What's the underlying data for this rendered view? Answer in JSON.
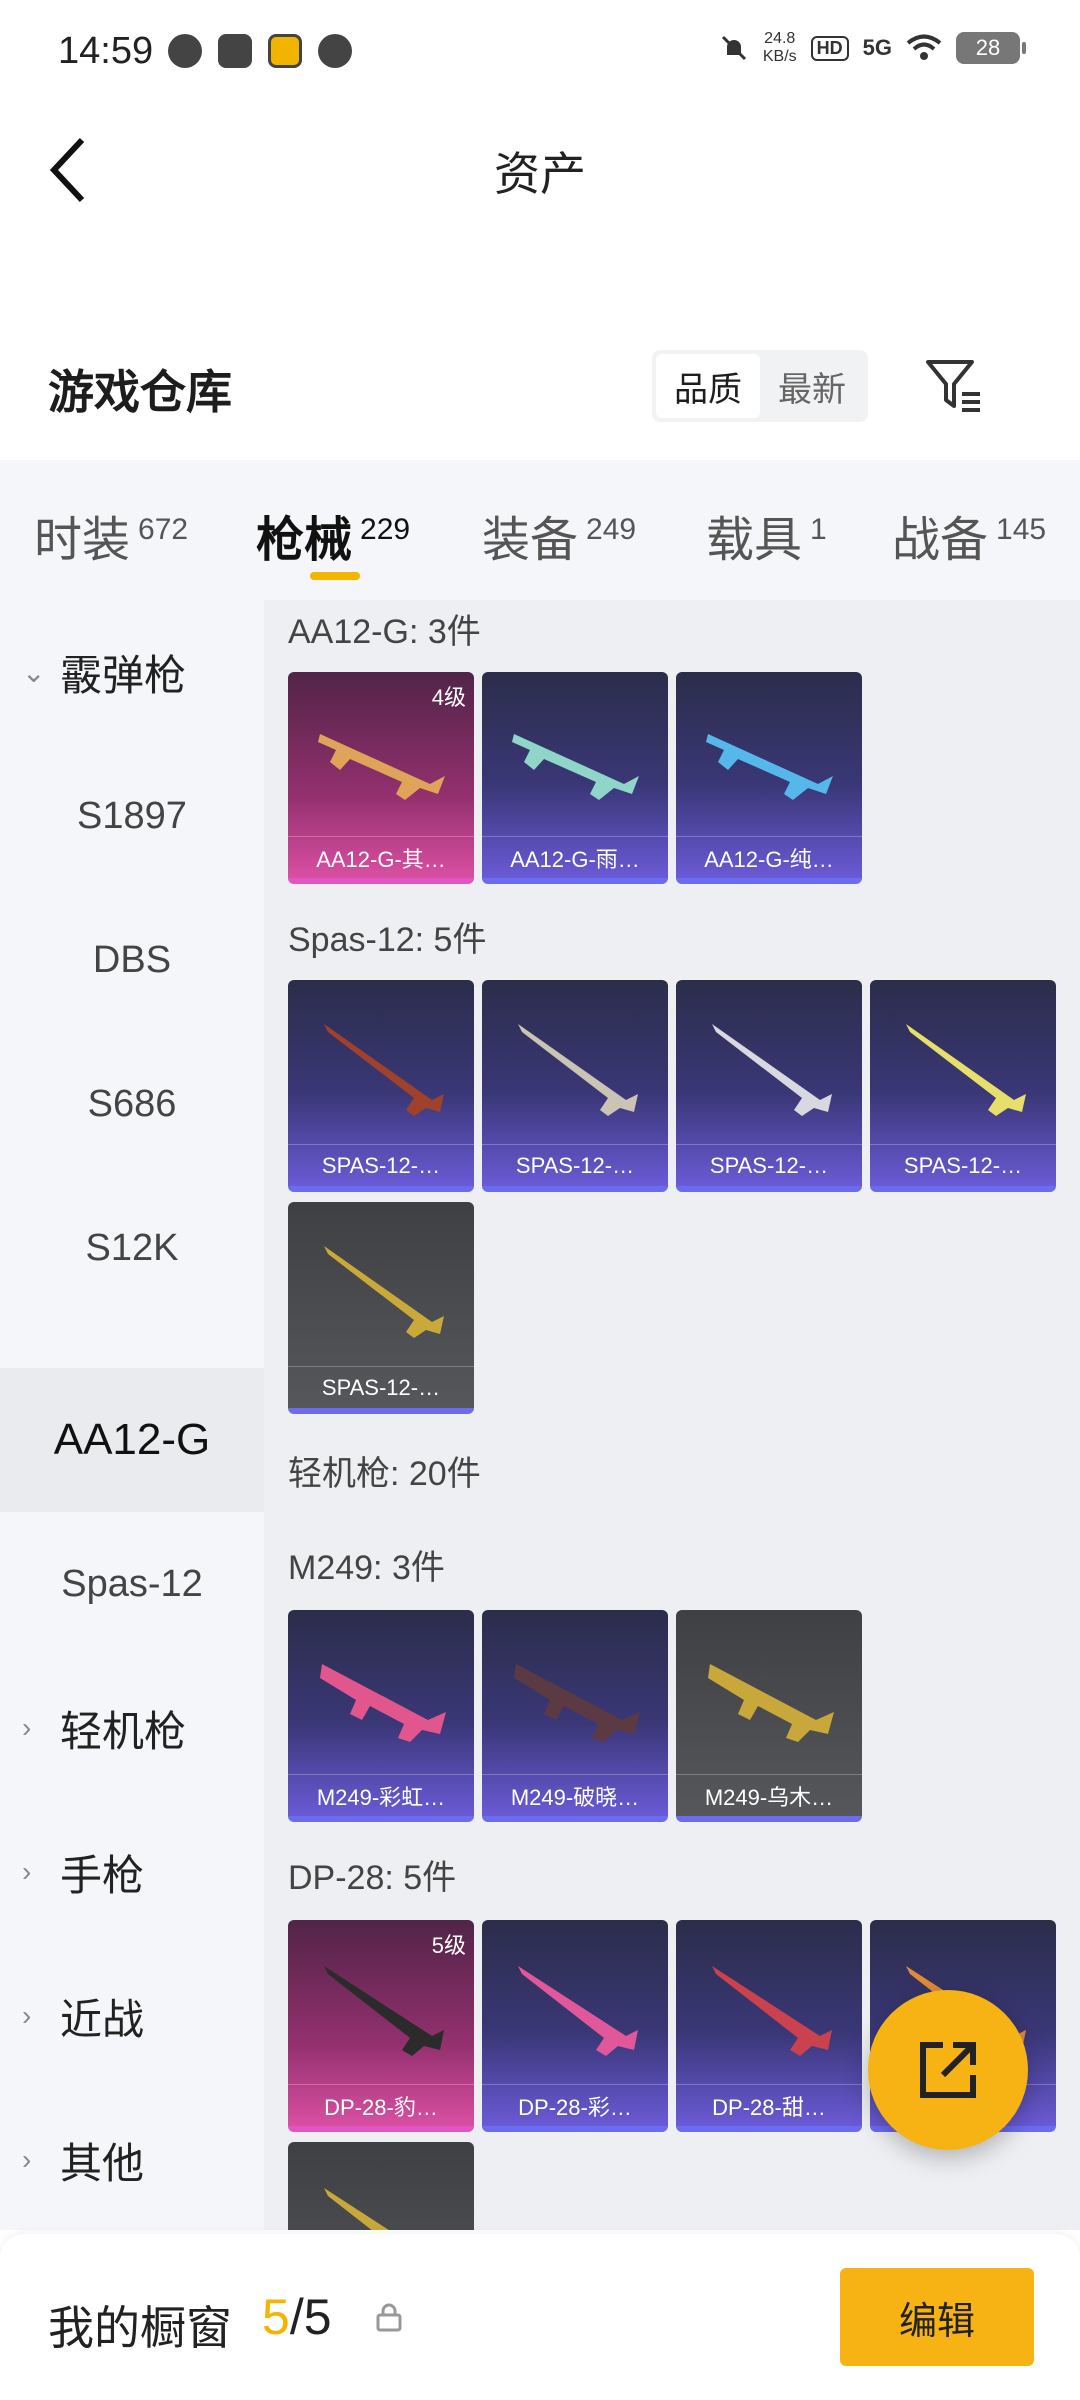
{
  "status_bar": {
    "time": "14:59",
    "speed_value": "24.8",
    "speed_unit": "KB/s",
    "hd": "HD",
    "network": "5G",
    "battery": "28"
  },
  "header": {
    "title": "资产"
  },
  "section": {
    "title": "游戏仓库",
    "sort_options": [
      "品质",
      "最新"
    ],
    "selected_sort": "品质"
  },
  "tabs": [
    {
      "label": "时装",
      "count": "672"
    },
    {
      "label": "枪械",
      "count": "229"
    },
    {
      "label": "装备",
      "count": "249"
    },
    {
      "label": "载具",
      "count": "1"
    },
    {
      "label": "战备",
      "count": "145"
    }
  ],
  "sidebar": {
    "items": [
      {
        "label": "霰弹枪",
        "type": "category"
      },
      {
        "label": "S1897",
        "type": "sub"
      },
      {
        "label": "DBS",
        "type": "sub"
      },
      {
        "label": "S686",
        "type": "sub"
      },
      {
        "label": "S12K",
        "type": "sub"
      },
      {
        "label": "AA12-G",
        "type": "sub",
        "active": true
      },
      {
        "label": "Spas-12",
        "type": "sub"
      },
      {
        "label": "轻机枪",
        "type": "category"
      },
      {
        "label": "手枪",
        "type": "category"
      },
      {
        "label": "近战",
        "type": "category"
      },
      {
        "label": "其他",
        "type": "category"
      }
    ]
  },
  "groups": [
    {
      "title": "AA12-G: 3件",
      "cards": [
        {
          "label": "AA12-G-其…",
          "level": "4级",
          "style": "pink"
        },
        {
          "label": "AA12-G-雨…",
          "style": "purple"
        },
        {
          "label": "AA12-G-纯…",
          "style": "purple"
        }
      ]
    },
    {
      "title": "Spas-12: 5件",
      "cards": [
        {
          "label": "SPAS-12-…",
          "style": "purple"
        },
        {
          "label": "SPAS-12-…",
          "style": "purple"
        },
        {
          "label": "SPAS-12-…",
          "style": "purple"
        },
        {
          "label": "SPAS-12-…",
          "style": "purple"
        },
        {
          "label": "SPAS-12-…",
          "style": "grey"
        }
      ]
    },
    {
      "title": "轻机枪: 20件",
      "cards": []
    },
    {
      "title": "M249: 3件",
      "cards": [
        {
          "label": "M249-彩虹…",
          "style": "purple"
        },
        {
          "label": "M249-破晓…",
          "style": "purple"
        },
        {
          "label": "M249-乌木…",
          "style": "grey"
        }
      ]
    },
    {
      "title": "DP-28: 5件",
      "cards": [
        {
          "label": "DP-28-豹…",
          "level": "5级",
          "style": "pink"
        },
        {
          "label": "DP-28-彩…",
          "style": "purple"
        },
        {
          "label": "DP-28-甜…",
          "style": "purple"
        },
        {
          "label": "",
          "style": "purple"
        },
        {
          "label": "",
          "style": "grey"
        }
      ]
    }
  ],
  "bottom_bar": {
    "label": "我的橱窗",
    "current": "5",
    "total": "/5",
    "edit_label": "编辑"
  },
  "colors": {
    "accent": "#f7b313",
    "tab_indicator": "#f5b400",
    "purple_card": "#3a3777",
    "pink_card": "#d94fa2",
    "grey_card": "#56575b"
  }
}
